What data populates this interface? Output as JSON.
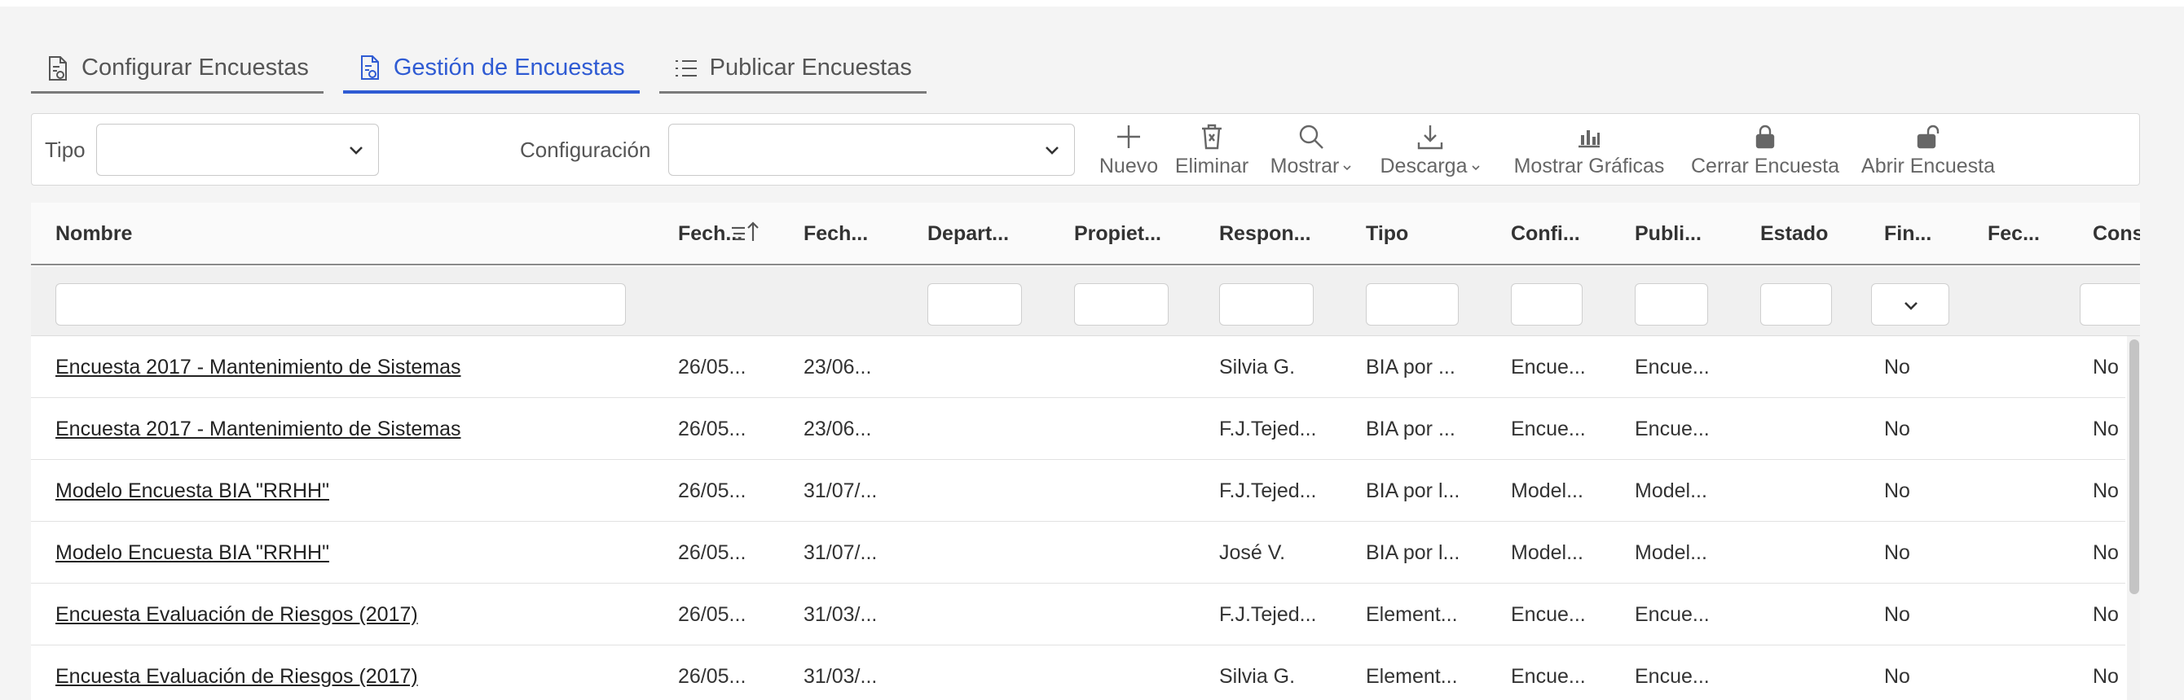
{
  "tabs": [
    {
      "label": "Configurar Encuestas",
      "icon": "document-gear-icon",
      "active": false
    },
    {
      "label": "Gestión de Encuestas",
      "icon": "document-gear-icon",
      "active": true
    },
    {
      "label": "Publicar Encuestas",
      "icon": "list-icon",
      "active": false
    }
  ],
  "filters": {
    "tipo_label": "Tipo",
    "tipo_value": "",
    "configuracion_label": "Configuración",
    "configuracion_value": ""
  },
  "toolbar": {
    "nuevo": "Nuevo",
    "eliminar": "Eliminar",
    "mostrar": "Mostrar",
    "descarga": "Descarga",
    "mostrar_graficas": "Mostrar Gráficas",
    "cerrar_encuesta": "Cerrar Encuesta",
    "abrir_encuesta": "Abrir Encuesta"
  },
  "colors": {
    "accent": "#2f5bd3",
    "text": "#333333",
    "border": "#d8d8d8"
  },
  "table": {
    "headers": [
      "Nombre",
      "Fech...",
      "Fech...",
      "Depart...",
      "Propiet...",
      "Respon...",
      "Tipo",
      "Confi...",
      "Publi...",
      "Estado",
      "Fin...",
      "Fec...",
      "Cons"
    ],
    "rows": [
      [
        "Encuesta 2017 - Mantenimiento de Sistemas",
        "26/05...",
        "23/06...",
        "",
        "",
        "Silvia G.",
        "BIA por ...",
        "Encue...",
        "Encue...",
        "",
        "No",
        "",
        "No"
      ],
      [
        "Encuesta 2017 - Mantenimiento de Sistemas",
        "26/05...",
        "23/06...",
        "",
        "",
        "F.J.Tejed...",
        "BIA por ...",
        "Encue...",
        "Encue...",
        "",
        "No",
        "",
        "No"
      ],
      [
        "Modelo Encuesta BIA \"RRHH\"",
        "26/05...",
        "31/07/...",
        "",
        "",
        "F.J.Tejed...",
        "BIA por l...",
        "Model...",
        "Model...",
        "",
        "No",
        "",
        "No"
      ],
      [
        "Modelo Encuesta BIA \"RRHH\"",
        "26/05...",
        "31/07/...",
        "",
        "",
        "José V.",
        "BIA por l...",
        "Model...",
        "Model...",
        "",
        "No",
        "",
        "No"
      ],
      [
        "Encuesta Evaluación de Riesgos (2017)",
        "26/05...",
        "31/03/...",
        "",
        "",
        "F.J.Tejed...",
        "Element...",
        "Encue...",
        "Encue...",
        "",
        "No",
        "",
        "No"
      ],
      [
        "Encuesta Evaluación de Riesgos (2017)",
        "26/05...",
        "31/03/...",
        "",
        "",
        "Silvia G.",
        "Element...",
        "Encue...",
        "Encue...",
        "",
        "No",
        "",
        "No"
      ]
    ]
  }
}
